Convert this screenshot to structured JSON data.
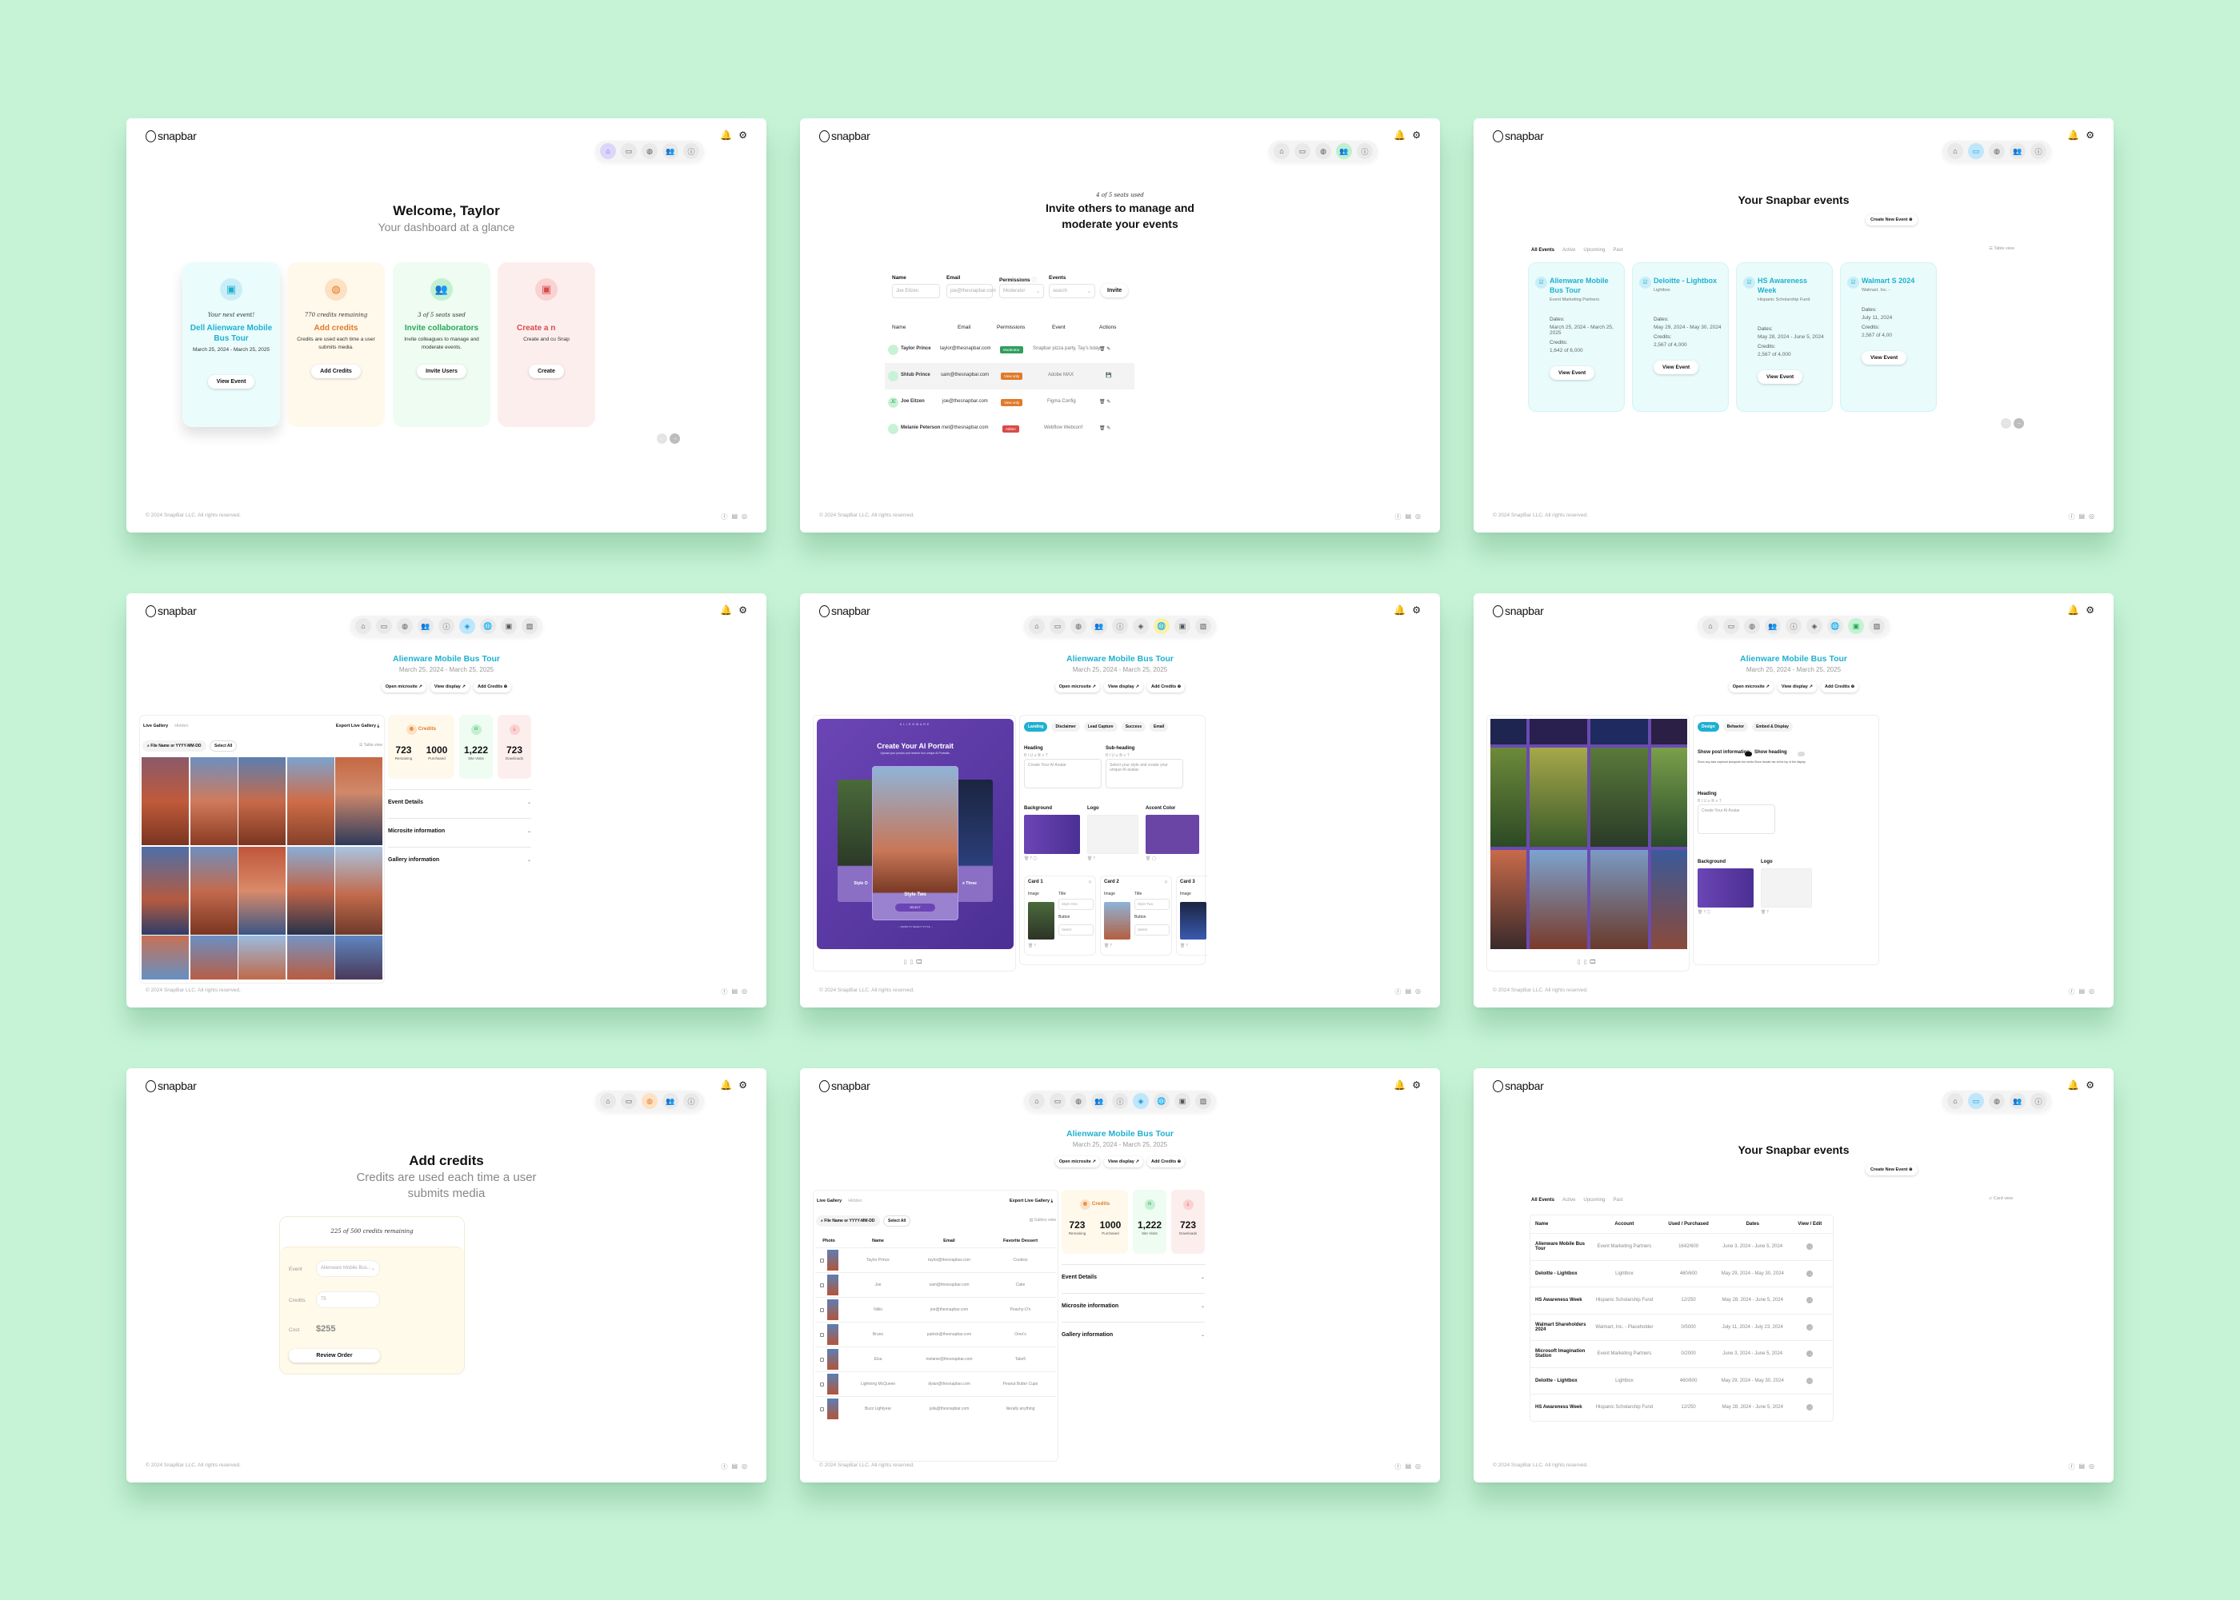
{
  "brand": {
    "logo_text": "snapbar"
  },
  "footer": {
    "copyright": "© 2024 SnapBar LLC. All rights reserved.",
    "social": [
      "facebook-icon",
      "linkedin-icon",
      "instagram-icon"
    ]
  },
  "colors": {
    "background": "#c6f3d6",
    "accent_cyan": "#1fb0d0",
    "orange": "#e07a2a",
    "green": "#2ba65a",
    "red": "#d94a4a",
    "purple": "#5a3aa6"
  },
  "nav_glyphs": {
    "home": "⌂",
    "events": "▭",
    "credits": "◍",
    "users": "👥",
    "info": "ⓘ",
    "gallery": "◈",
    "microsite": "🌐",
    "display": "▣",
    "media": "▨",
    "bell": "🔔",
    "gear": "⚙"
  },
  "dashboard": {
    "title": "Welcome, Taylor",
    "subtitle": "Your dashboard at a glance",
    "cards": [
      {
        "kicker": "Your next event!",
        "title": "Dell Alienware Mobile Bus Tour",
        "desc": "March 25, 2024 - March 25, 2025",
        "button": "View Event"
      },
      {
        "kicker": "770 credits remaining",
        "title": "Add credits",
        "desc": "Credits are used each time a user submits media.",
        "button": "Add Credits"
      },
      {
        "kicker": "3 of 5 seats used",
        "title": "Invite collaborators",
        "desc": "Invite colleagues to manage and moderate events.",
        "button": "Invite Users"
      },
      {
        "kicker": "",
        "title": "Create a n",
        "desc": "Create and cu Snap",
        "button": "Create"
      }
    ]
  },
  "invite": {
    "kicker": "4 of 5 seats used",
    "title_line1": "Invite others to manage and",
    "title_line2": "moderate your events",
    "form": {
      "name_label": "Name",
      "name_placeholder": "Joe Eitzen",
      "email_label": "Email",
      "email_placeholder": "joe@thesnapbar.com",
      "permissions_label": "Permissions",
      "permissions_value": "Moderator",
      "events_label": "Events",
      "events_placeholder": "search",
      "invite_button": "Invite"
    },
    "columns": [
      "Name",
      "Email",
      "Permissions",
      "Event",
      "Actions"
    ],
    "rows": [
      {
        "initials": "",
        "name": "Taylor Prince",
        "email": "taylor@thesnapbar.com",
        "permission": "Moderator",
        "perm_color": "#2f9e5e",
        "event": "Snapbar pizza party, Tay's bday",
        "actions": "🗑 ✎"
      },
      {
        "initials": "",
        "name": "Shlub Prince",
        "email": "sam@thesnapbar.com",
        "permission": "View only",
        "perm_color": "#e07a2a",
        "event": "Adobe MAX",
        "actions": "💾"
      },
      {
        "initials": "JE",
        "name": "Joe Eitzen",
        "email": "joe@thesnapbar.com",
        "permission": "View only",
        "perm_color": "#e07a2a",
        "event": "Figma Config",
        "actions": "🗑 ✎"
      },
      {
        "initials": "",
        "name": "Melanie Peterson",
        "email": "mel@thesnapbar.com",
        "permission": "Admin",
        "perm_color": "#d94a4a",
        "event": "Webflow Webconf",
        "actions": "🗑 ✎"
      }
    ]
  },
  "events": {
    "title": "Your Snapbar events",
    "create_button": "Create New Event",
    "tabs": [
      "All Events",
      "Active",
      "Upcoming",
      "Past"
    ],
    "table_view_label": "Table view",
    "card_view_label": "Card view",
    "dates_label": "Dates:",
    "credits_label": "Credits:",
    "view_button": "View Event",
    "cards": [
      {
        "name": "Alienware Mobile Bus Tour",
        "account": "Event Marketing Partners",
        "dates": "March 25, 2024 - March 25, 2025",
        "credits": "1,642 of 6,000"
      },
      {
        "name": "Deloitte - Lightbox",
        "account": "Lightbox",
        "dates": "May 29, 2024 - May 30, 2024",
        "credits": "2,567 of 4,000"
      },
      {
        "name": "HS Awareness Week",
        "account": "Hispanic Scholarship Fund",
        "dates": "May 28, 2024 - June 5, 2024",
        "credits": "2,567 of 4,000"
      },
      {
        "name": "Walmart S 2024",
        "account": "Walmart, Inc. -",
        "dates": "July 11, 2024",
        "credits": "2,567 of 4,00"
      }
    ],
    "table_columns": [
      "Name",
      "Account",
      "Used / Purchased",
      "Dates",
      "View / Edit"
    ],
    "table_rows": [
      {
        "name": "Alienware Mobile Bus Tour",
        "account": "Event Marketing Partners",
        "used": "1642/600",
        "dates": "June 3, 2024 - June 5, 2024"
      },
      {
        "name": "Deloitte - Lightbox",
        "account": "Lightbox",
        "used": "460/600",
        "dates": "May 29, 2024 - May 30, 2024"
      },
      {
        "name": "HS Awareness Week",
        "account": "Hispanic Scholarship Fund",
        "used": "12/250",
        "dates": "May 28, 2024 - June 5, 2024"
      },
      {
        "name": "Walmart Shareholders 2024",
        "account": "Walmart, Inc. - Placeholder",
        "used": "0/5000",
        "dates": "July 11, 2024 - July 23, 2024"
      },
      {
        "name": "Microsoft Imagination Station",
        "account": "Event Marketing Partners",
        "used": "0/2000",
        "dates": "June 3, 2024 - June 5, 2024"
      },
      {
        "name": "Deloitte - Lightbox",
        "account": "Lightbox",
        "used": "460/600",
        "dates": "May 29, 2024 - May 30, 2024"
      },
      {
        "name": "HS Awareness Week",
        "account": "Hispanic Scholarship Fund",
        "used": "12/250",
        "dates": "May 28, 2024 - June 5, 2024"
      }
    ]
  },
  "event_detail": {
    "title": "Alienware Mobile Bus Tour",
    "dates": "March 25, 2024  - March 25, 2025",
    "buttons": [
      "Open microsite ↗",
      "View display ↗",
      "Add Credits ⊕"
    ],
    "gallery_tabs": [
      "Live Gallery",
      "Hidden"
    ],
    "export_label": "Export Live Gallery ⤓",
    "search_placeholder": "File Name or YYYY-MM-DD",
    "select_all": "Select All",
    "table_view": "Table view",
    "gallery_view": "Gallery view",
    "thumb_caption": "2024-05-23T16_28_27...",
    "credits_label": "Credits",
    "stats": {
      "remaining": "723",
      "remaining_label": "Remaining",
      "purchased": "1000",
      "purchased_label": "Purchased",
      "site_visits": "1,222",
      "site_visits_label": "Site Visits",
      "downloads": "723",
      "downloads_label": "Downloads"
    },
    "accordions": [
      "Event Details",
      "Microsite information",
      "Gallery information"
    ],
    "gallery_columns": [
      "Photo",
      "Name",
      "Email",
      "Favorite Dessert"
    ],
    "gallery_rows": [
      {
        "name": "Taylor Prince",
        "email": "taylor@thesnapbar.com",
        "dessert": "Cookies"
      },
      {
        "name": "Joe",
        "email": "sam@thesnapbar.com",
        "dessert": "Cake"
      },
      {
        "name": "Nikki",
        "email": "joe@thesnapbar.com",
        "dessert": "Peachy-O's"
      },
      {
        "name": "Bruno",
        "email": "patrick@thesnapbar.com",
        "dessert": "Oreo's"
      },
      {
        "name": "Elsa",
        "email": "melanie@thesnapbar.com",
        "dessert": "Take5"
      },
      {
        "name": "Lightning McQueen",
        "email": "dylan@thesnapbar.com",
        "dessert": "Peanut Butter Cups"
      },
      {
        "name": "Buzz Lightyear",
        "email": "julia@thesnapbar.com",
        "dessert": "literally anything"
      }
    ]
  },
  "microsite": {
    "tabs": [
      "Landing",
      "Disclaimer",
      "Lead Capture",
      "Success",
      "Email"
    ],
    "preview": {
      "brand": "ALIENWARE",
      "heading": "Create Your AI Portrait",
      "subheading": "Upload your photos and receive four unique AI Portraits.",
      "center_style": "Style Two",
      "left_style": "Style O",
      "right_style": "e Three",
      "select": "SELECT",
      "swipe": "← SWIPE TO SELECT STYLE →"
    },
    "heading_label": "Heading",
    "heading_value": "Create Your AI Avatar",
    "subheading_label": "Sub-heading",
    "subheading_value": "Select your style and create your unique AI avatar.",
    "background_label": "Background",
    "logo_label": "Logo",
    "accent_label": "Accent Color",
    "cards": [
      {
        "title": "Card 1",
        "image_label": "Image",
        "title_label": "Title",
        "title_value": "Style One",
        "button_label": "Button",
        "button_value": "Select"
      },
      {
        "title": "Card 2",
        "image_label": "Image",
        "title_label": "Title",
        "title_value": "Style Two",
        "button_label": "Button",
        "button_value": "Select"
      },
      {
        "title": "Card 3",
        "image_label": "Image",
        "title_label": "Ti",
        "title_value": "S",
        "button_label": "Bu",
        "button_value": "S"
      }
    ],
    "toolbar": "B I U ⌀ ≣ ≡ T"
  },
  "display": {
    "tabs": [
      "Design",
      "Behavior",
      "Embed & Display"
    ],
    "show_post_info": {
      "label": "Show post information",
      "desc": "Show any data captured alongside the media",
      "on": true
    },
    "show_heading": {
      "label": "Show heading",
      "desc": "Show header bar at the top of the display",
      "on": false
    },
    "heading_label": "Heading",
    "heading_value": "Create Your AI Avatar",
    "background_label": "Background",
    "logo_label": "Logo"
  },
  "add_credits": {
    "title": "Add credits",
    "subtitle_line1": "Credits are used each time a user",
    "subtitle_line2": "submits media",
    "kicker": "225 of 500 credits remaining",
    "event_label": "Event",
    "event_value": "Alienware Mobile Bus...",
    "credits_label": "Credits",
    "credits_value": "75",
    "cost_label": "Cost",
    "cost_value": "$255",
    "review_button": "Review Order"
  }
}
